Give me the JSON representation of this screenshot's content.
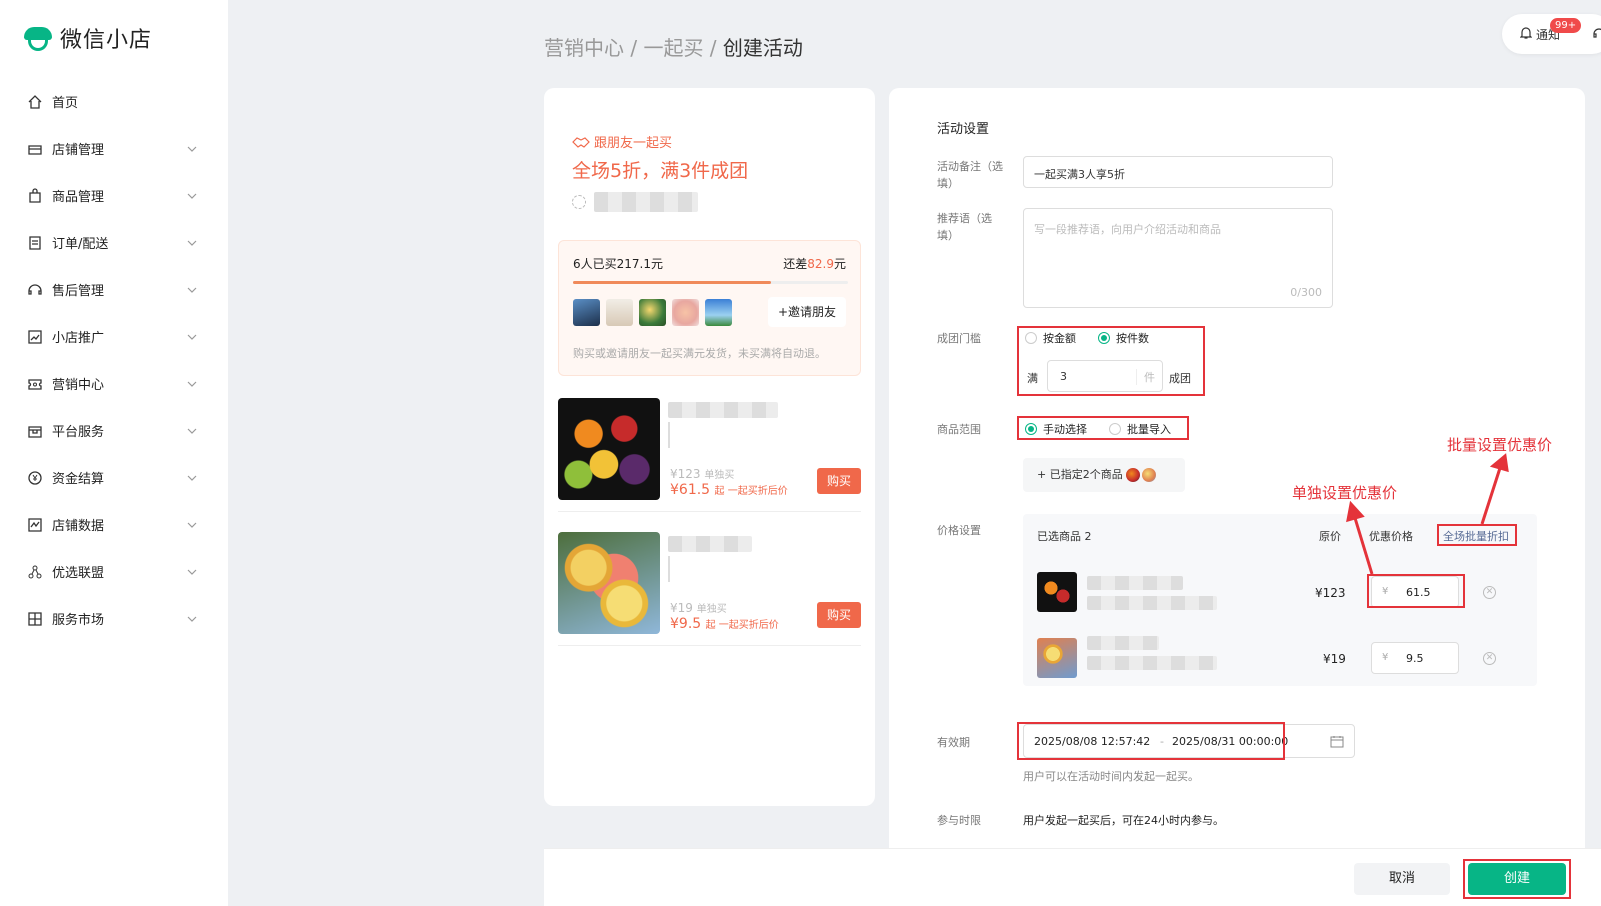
{
  "app": {
    "name": "微信小店"
  },
  "sidebar": {
    "items": [
      {
        "label": "首页",
        "icon": "home-icon"
      },
      {
        "label": "店铺管理",
        "icon": "store-icon"
      },
      {
        "label": "商品管理",
        "icon": "shopping-bag-icon"
      },
      {
        "label": "订单/配送",
        "icon": "order-icon"
      },
      {
        "label": "售后管理",
        "icon": "headset-icon"
      },
      {
        "label": "小店推广",
        "icon": "trend-chart-icon"
      },
      {
        "label": "营销中心",
        "icon": "ticket-icon"
      },
      {
        "label": "平台服务",
        "icon": "service-box-icon"
      },
      {
        "label": "资金结算",
        "icon": "yuan-coin-icon"
      },
      {
        "label": "店铺数据",
        "icon": "data-chart-icon"
      },
      {
        "label": "优选联盟",
        "icon": "network-icon"
      },
      {
        "label": "服务市场",
        "icon": "market-icon"
      }
    ]
  },
  "header": {
    "breadcrumb": [
      "营销中心",
      "一起买",
      "创建活动"
    ],
    "separator": " / ",
    "notification_label": "通知",
    "notification_badge": "99+"
  },
  "preview": {
    "tag": "跟朋友一起买",
    "title": "全场5折，满3件成团",
    "bought_text": "6人已买217.1元",
    "remaining_prefix": "还差",
    "remaining_amount": "82.9",
    "remaining_suffix": "元",
    "progress": 0.72,
    "invite_label": "+邀请朋友",
    "note": "购买或邀请朋友一起买满元发货，未买满将自动退。",
    "products": [
      {
        "orig_price": "¥123",
        "orig_suffix": "单独买",
        "disc_price": "¥61.5",
        "disc_suffix": "起 一起买折后价",
        "buy_label": "购买"
      },
      {
        "orig_price": "¥19",
        "orig_suffix": "单独买",
        "disc_price": "¥9.5",
        "disc_suffix": "起 一起买折后价",
        "buy_label": "购买"
      }
    ]
  },
  "form": {
    "section_title": "活动设置",
    "remark_label": "活动备注（选填）",
    "remark_value": "一起买满3人享5折",
    "slogan_label": "推荐语（选填）",
    "slogan_placeholder": "写一段推荐语，向用户介绍活动和商品",
    "slogan_count": "0/300",
    "threshold_label": "成团门槛",
    "threshold_options": [
      "按金额",
      "按件数"
    ],
    "threshold_selected": 1,
    "threshold_prefix": "满",
    "threshold_value": "3",
    "threshold_unit": "件",
    "threshold_suffix": "成团",
    "scope_label": "商品范围",
    "scope_options": [
      "手动选择",
      "批量导入"
    ],
    "scope_selected": 0,
    "selected_goods_btn": "+ 已指定2个商品",
    "price_label": "价格设置",
    "price_table": {
      "header_selected": "已选商品 2",
      "header_orig": "原价",
      "header_disc": "优惠价格",
      "bulk_link": "全场批量折扣",
      "currency": "¥",
      "rows": [
        {
          "orig": "¥123",
          "disc": "61.5"
        },
        {
          "orig": "¥19",
          "disc": "9.5"
        }
      ]
    },
    "validity_label": "有效期",
    "validity_start": "2025/08/08 12:57:42",
    "validity_sep": "-",
    "validity_end": "2025/08/31 00:00:00",
    "validity_hint": "用户可以在活动时间内发起一起买。",
    "participate_label": "参与时限",
    "participate_text": "用户发起一起买后，可在24小时内参与。"
  },
  "annotations": {
    "single_price": "单独设置优惠价",
    "bulk_price": "批量设置优惠价"
  },
  "actions": {
    "cancel": "取消",
    "create": "创建"
  },
  "colors": {
    "brand": "#07b586",
    "accent": "#f0684a",
    "annotation": "#e4333a"
  }
}
